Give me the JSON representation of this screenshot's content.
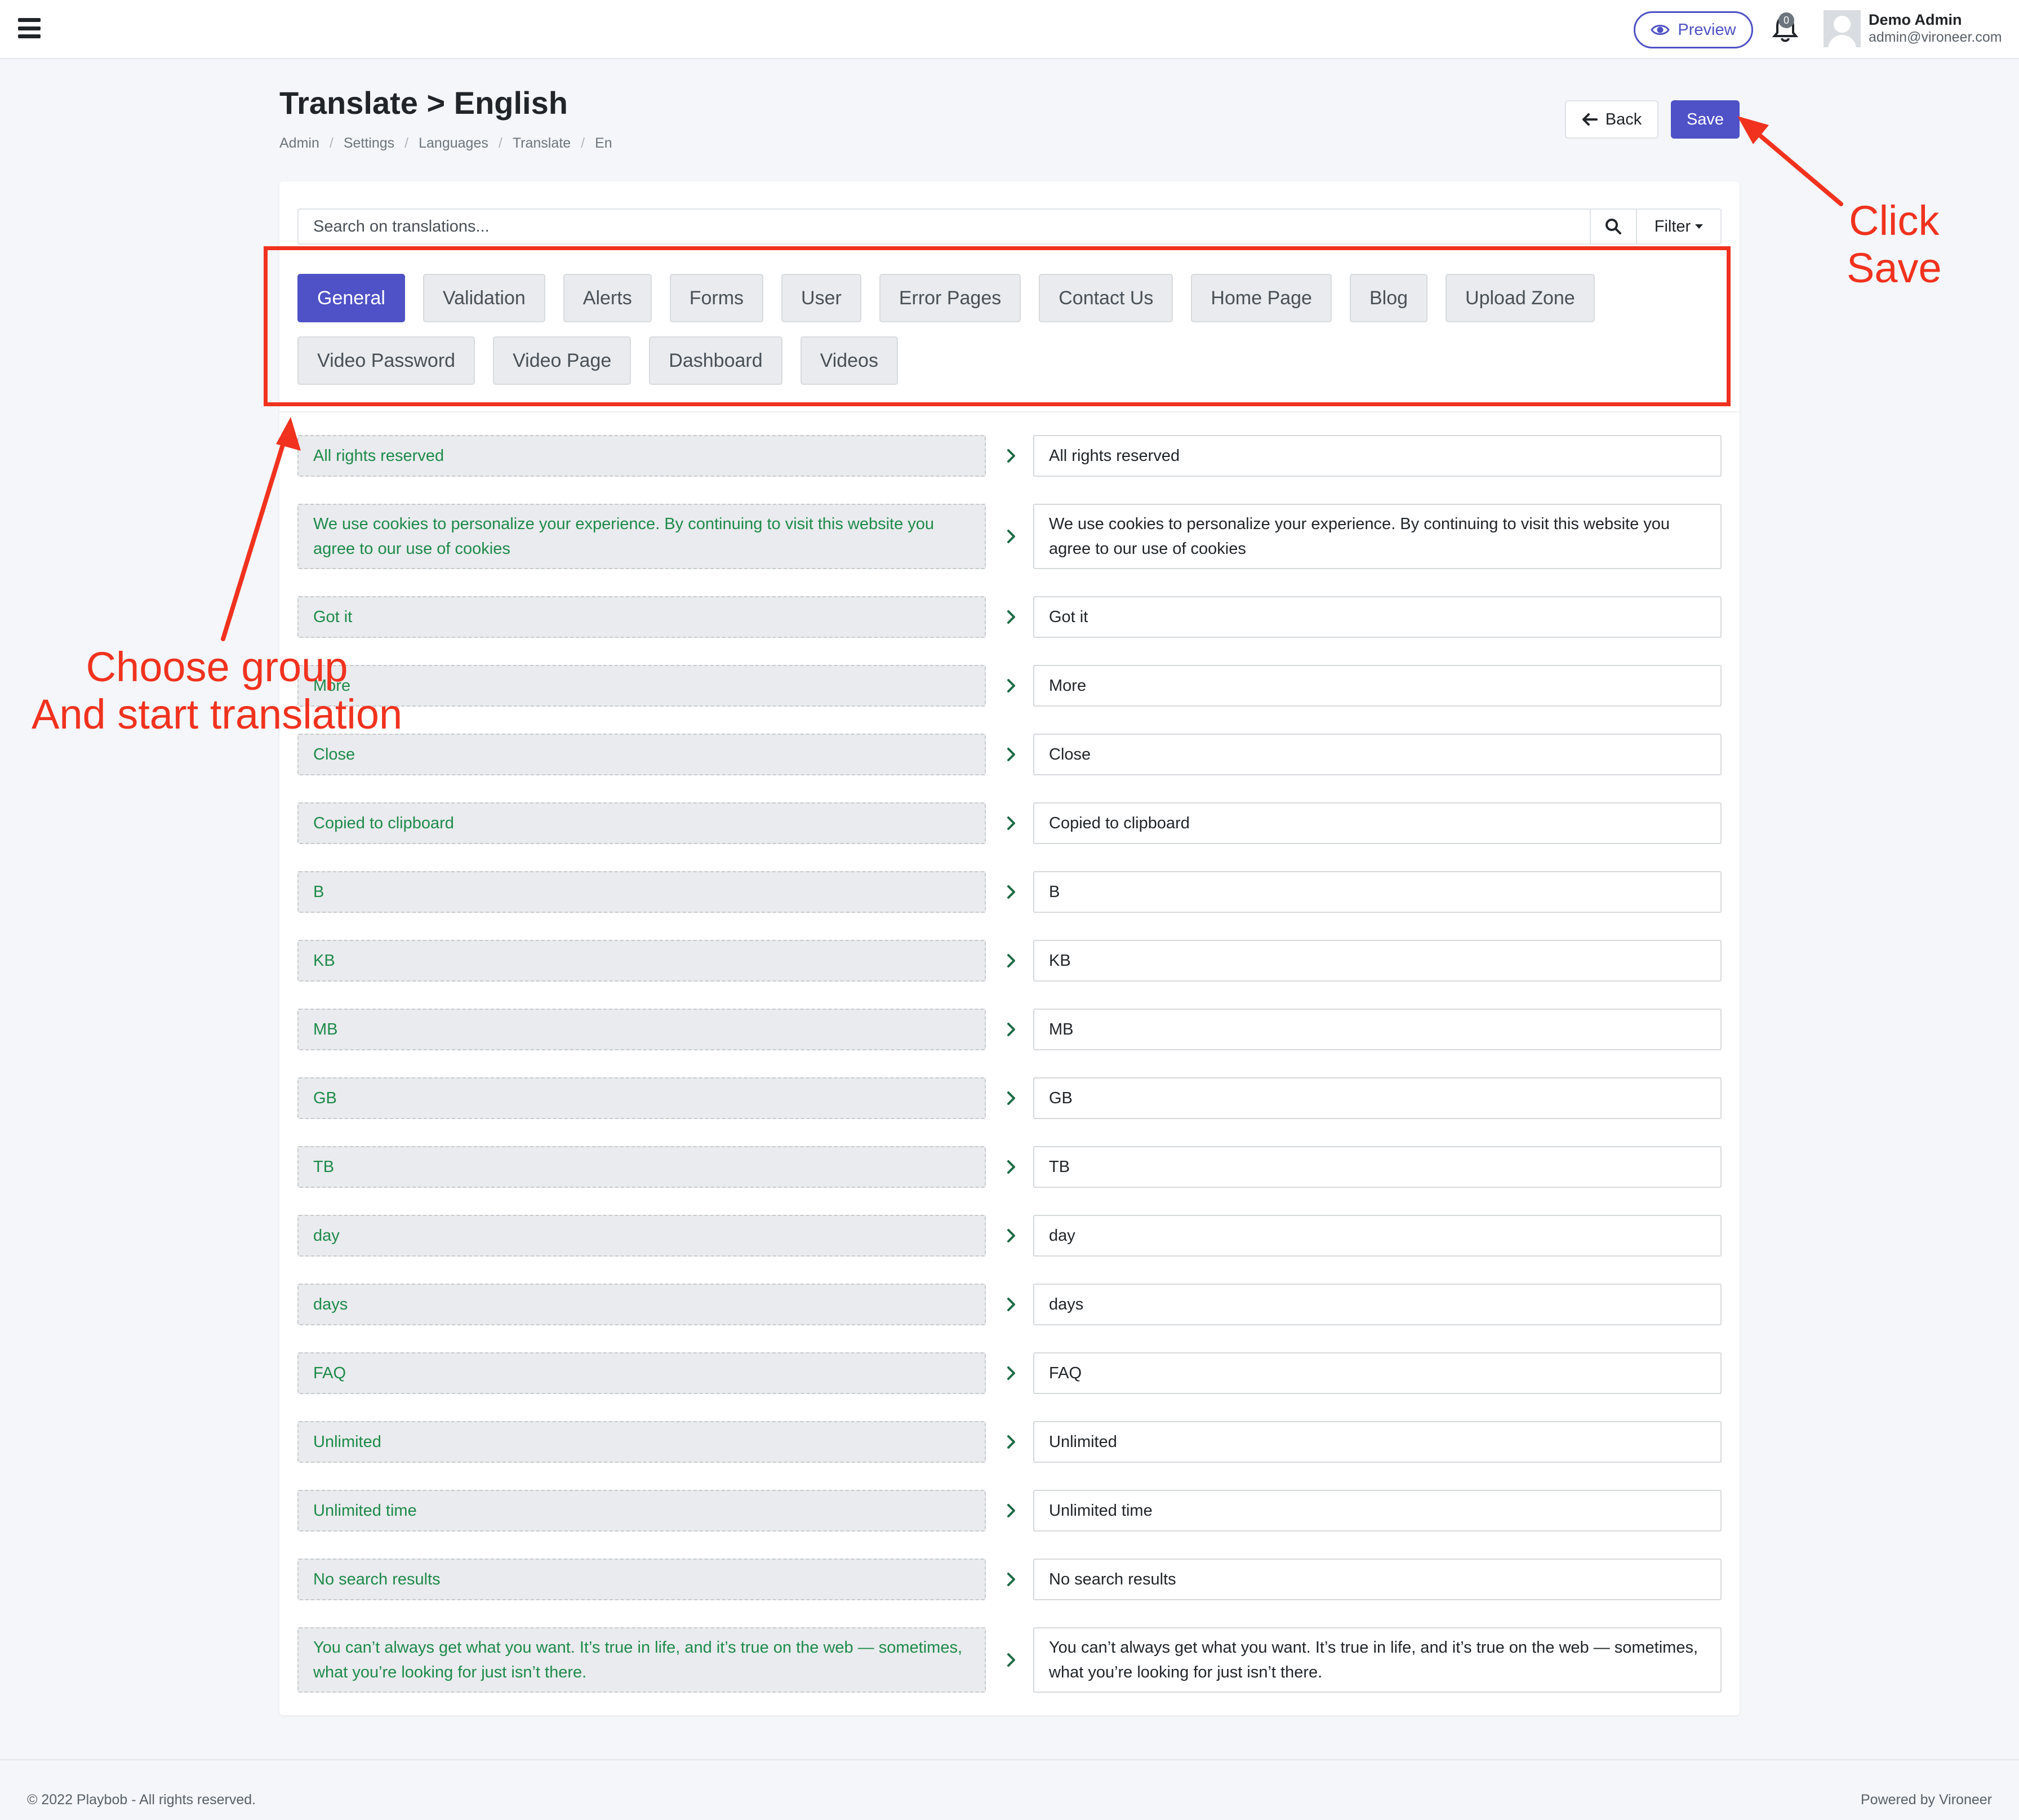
{
  "topbar": {
    "preview_label": "Preview",
    "notification_count": "0",
    "user_name": "Demo Admin",
    "user_email": "admin@vironeer.com"
  },
  "header": {
    "title": "Translate > English",
    "breadcrumb": [
      "Admin",
      "Settings",
      "Languages",
      "Translate",
      "En"
    ],
    "back_label": "Back",
    "save_label": "Save"
  },
  "search": {
    "placeholder": "Search on translations...",
    "filter_label": "Filter"
  },
  "groups": {
    "active": "General",
    "row1": [
      "General",
      "Validation",
      "Alerts",
      "Forms",
      "User",
      "Error Pages",
      "Contact Us",
      "Home Page",
      "Blog",
      "Upload Zone"
    ],
    "row2": [
      "Video Password",
      "Video Page",
      "Dashboard",
      "Videos"
    ]
  },
  "translations": [
    {
      "key": "All rights reserved",
      "value": "All rights reserved"
    },
    {
      "key": "We use cookies to personalize your experience. By continuing to visit this website you agree to our use of cookies",
      "value": "We use cookies to personalize your experience. By continuing to visit this website you agree to our use of cookies"
    },
    {
      "key": "Got it",
      "value": "Got it"
    },
    {
      "key": "More",
      "value": "More"
    },
    {
      "key": "Close",
      "value": "Close"
    },
    {
      "key": "Copied to clipboard",
      "value": "Copied to clipboard"
    },
    {
      "key": "B",
      "value": "B"
    },
    {
      "key": "KB",
      "value": "KB"
    },
    {
      "key": "MB",
      "value": "MB"
    },
    {
      "key": "GB",
      "value": "GB"
    },
    {
      "key": "TB",
      "value": "TB"
    },
    {
      "key": "day",
      "value": "day"
    },
    {
      "key": "days",
      "value": "days"
    },
    {
      "key": "FAQ",
      "value": "FAQ"
    },
    {
      "key": "Unlimited",
      "value": "Unlimited"
    },
    {
      "key": "Unlimited time",
      "value": "Unlimited time"
    },
    {
      "key": "No search results",
      "value": "No search results"
    },
    {
      "key": "You can’t always get what you want. It’s true in life, and it’s true on the web — sometimes, what you’re looking for just isn’t there.",
      "value": "You can’t always get what you want. It’s true in life, and it’s true on the web — sometimes, what you’re looking for just isn’t there."
    }
  ],
  "footer": {
    "copyright": "© 2022 Playbob - All rights reserved.",
    "powered": "Powered by Vironeer"
  },
  "annotations": {
    "save_hint": [
      "Click",
      "Save"
    ],
    "group_hint": [
      "Choose group",
      "And start translation"
    ]
  },
  "colors": {
    "accent": "#4f51c6",
    "key_text": "#1e8a4a",
    "annotation": "#f0321e"
  }
}
